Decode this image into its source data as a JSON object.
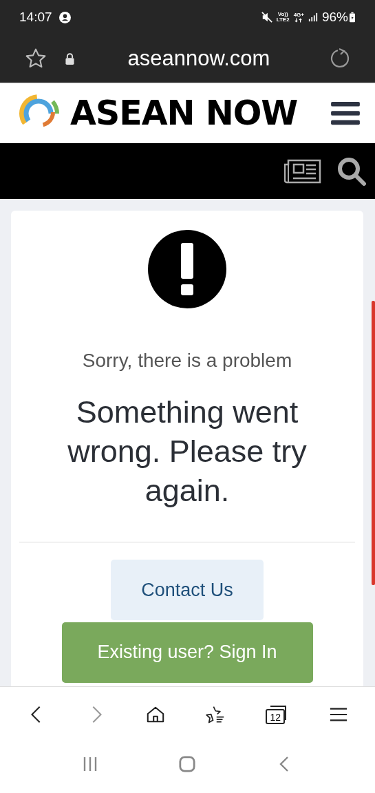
{
  "status_bar": {
    "time": "14:07",
    "volte": "Vo))",
    "lte": "LTE2",
    "network": "4G+",
    "battery": "96%"
  },
  "browser": {
    "url": "aseannow.com",
    "tab_count": "12"
  },
  "site": {
    "logo_text": "ASEAN NOW"
  },
  "error_card": {
    "subtitle": "Sorry, there is a problem",
    "message": "Something went wrong. Please try again.",
    "buttons": [
      {
        "label": "Contact Us",
        "kind": "secondary"
      },
      {
        "label": "Existing user? Sign In",
        "kind": "primary"
      }
    ]
  }
}
